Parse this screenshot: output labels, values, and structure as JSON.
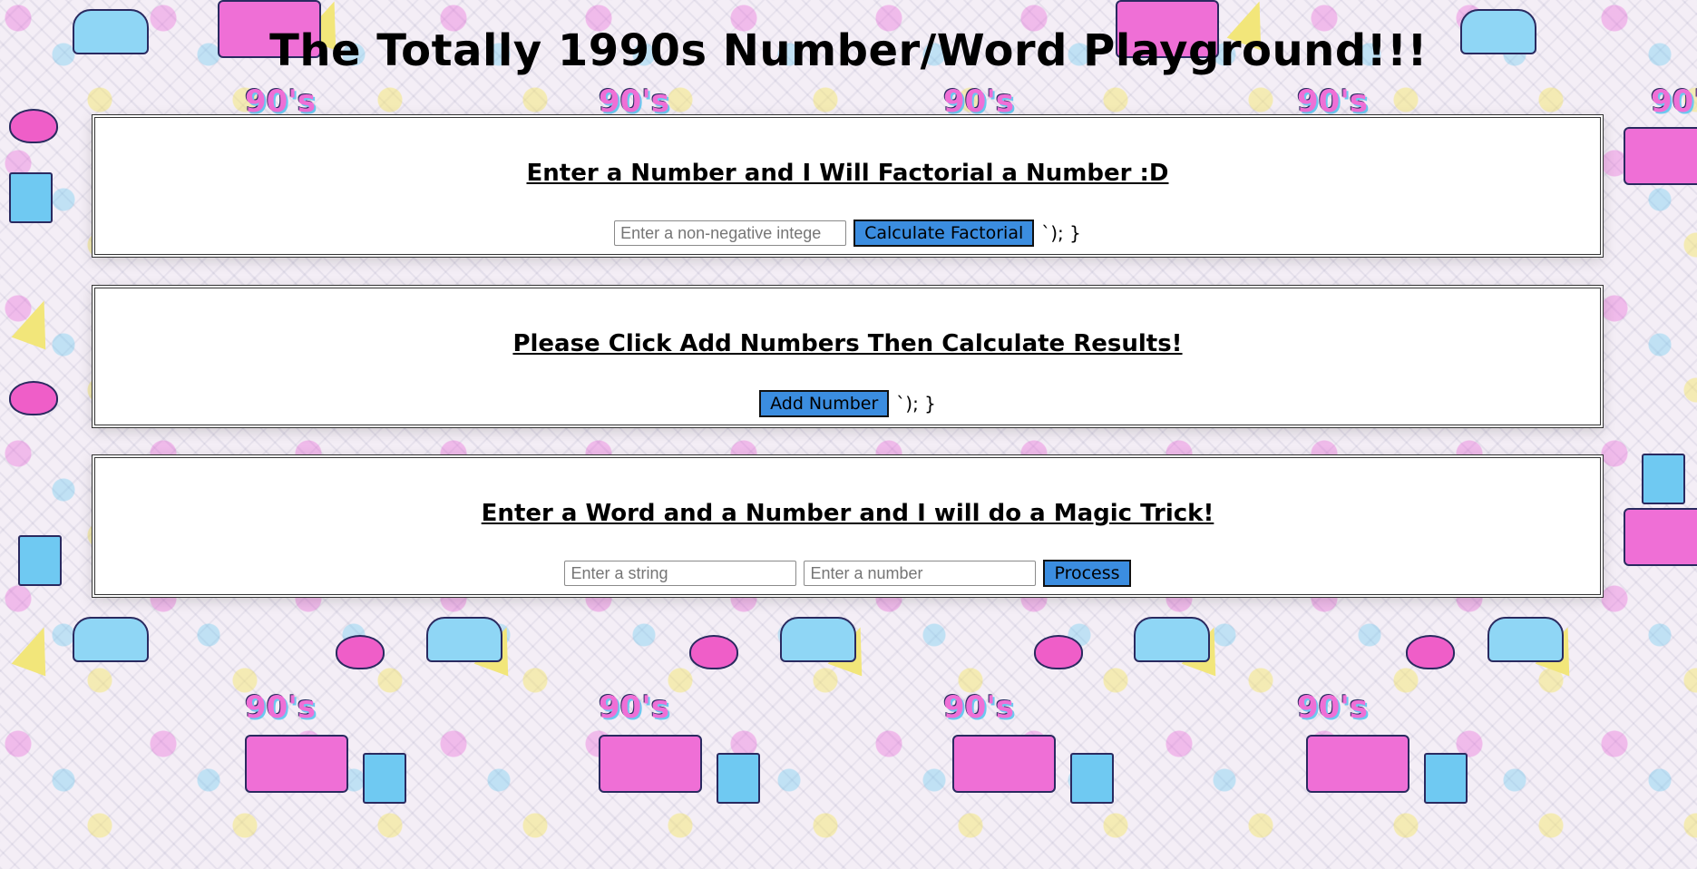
{
  "page": {
    "title": "The Totally 1990s Number/Word Playground!!!"
  },
  "factorial": {
    "heading": "Enter a Number and I Will Factorial a Number :D",
    "input_placeholder": "Enter a non-negative intege",
    "button_label": "Calculate Factorial",
    "stray_text": "`); }"
  },
  "adder": {
    "heading": "Please Click Add Numbers Then Calculate Results!",
    "button_label": "Add Number",
    "stray_text": "`); }"
  },
  "magic": {
    "heading": "Enter a Word and a Number and I will do a Magic Trick!",
    "string_placeholder": "Enter a string",
    "number_placeholder": "Enter a number",
    "button_label": "Process"
  },
  "background": {
    "decal_text": "90's"
  },
  "colors": {
    "button": "#3b8de0",
    "panel": "#ffffff",
    "accent_pink": "#ef6fd6",
    "accent_blue": "#6fc9f2",
    "accent_yellow": "#f2e67a"
  }
}
